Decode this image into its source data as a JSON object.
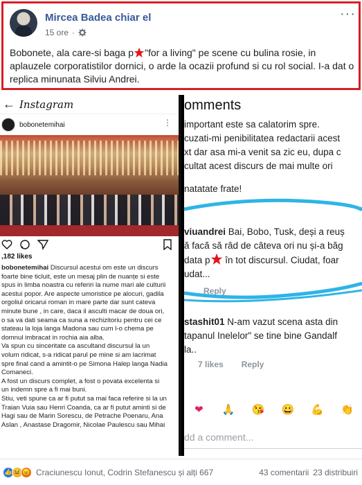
{
  "post": {
    "author": "Mircea Badea chiar el",
    "time": "15 ore",
    "more": "···",
    "text_part1": "Bobonete, ala care-si baga p",
    "text_part2": "\"for a living\" pe scene cu bulina rosie, in aplauzele corporatistilor dornici, o arde la ocazii profund si cu rol social. I-a dat o replica minunata Silviu Andrei."
  },
  "instagram": {
    "back": "←",
    "logo": "Instagram",
    "username": "bobonetemihai",
    "more": "⋮",
    "likes": ",182 likes",
    "caption_user": "bobonetemihai",
    "caption_lines": [
      "Discursul acestui om este un discurs",
      "foarte bine ticluit, este un mesaj plin de nuanțe si este",
      "spus in limba noastra cu referiri la nume mari ale culturii",
      "acestui popor. Are aspecte umoristice pe alocuri, gadila",
      "orgoliul oricarui roman in mare parte dar sunt cateva",
      "minute bune , in care, daca il asculti macar de doua ori,",
      "o sa va dati seama ca suna a rechizitoriu pentru cei ce",
      "stateau la loja langa Madona sau cum l-o chema pe",
      "domnul imbracat in  rochia aia alba.",
      "Va spun cu sinceritate ca ascultand discursul la un",
      "volum ridicat, s-a ridicat parul pe mine si am lacrimat",
      "spre final cand a amintit-o pe Simona Halep langa Nadia",
      "Comaneci.",
      "A fost un discurs complet, a fost o povata excelenta si",
      "un indemn spre a fi mai buni.",
      "Stiu, veti spune ca ar fi putut sa mai faca referire si la  un",
      "Traian Vuia sau Henri Coanda, ca ar fi putut aminti si de",
      "Hagi sau de Marin Sorescu, de Petrache Poenaru, Ana",
      "Aslan , Anastase Dragomir, Nicolae Paulescu sau Mihai"
    ]
  },
  "comments": {
    "title": "omments",
    "lines_top": [
      "important este sa calatorim spre.",
      "cuzati-mi penibilitatea redactarii acest",
      "xt dar asa mi-a venit sa zic eu, dupa c",
      "cultat acest discurs de mai multe ori"
    ],
    "line_nice": "natatate frate!",
    "silviu_user": "viuandrei",
    "silviu_line1": " Bai, Bobo, Tusk, deși a reuș",
    "silviu_line2": "ă facă să râd de câteva ori nu și-a băg",
    "silviu_line3a": "data p",
    "silviu_line3b": " în tot discursul. Ciudat, foar",
    "silviu_line4": "udat...",
    "reply": "Reply",
    "third_user": "stashit01",
    "third_line1": " N-am vazut scena asta din",
    "third_line2": "tapanul Inelelor\" se tine bine Gandalf",
    "third_line3": "la..",
    "third_likes": "7 likes",
    "third_reply": "Reply",
    "input_placeholder": "dd a comment...",
    "emojis": [
      "❤",
      "🙏",
      "😘",
      "😀",
      "💪",
      "👏"
    ]
  },
  "footer": {
    "reaction_names": "Craciunescu Ionut, Codrin Stefanescu și alți 667",
    "comments_count": "43 comentarii",
    "shares_count": "23 distribuiri"
  },
  "colors": {
    "frame": "#d61f26",
    "link": "#385898",
    "star": "#e3141b",
    "scribble": "#2fb4e6"
  }
}
